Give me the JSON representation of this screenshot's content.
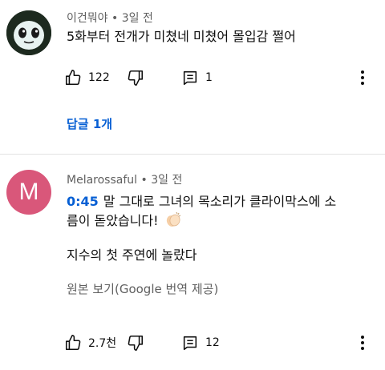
{
  "comments": [
    {
      "author": "이건뭐야",
      "time": "3일 전",
      "text": "5화부터 전개가 미쳤네 미쳤어 몰입감 쩔어",
      "likes": "122",
      "replies_count": "1",
      "view_replies_label": "답글 1개",
      "avatar_icon": "ghost-face-icon"
    },
    {
      "author": "Melarossaful",
      "time": "3일 전",
      "avatar_letter": "M",
      "avatar_color": "#d9577a",
      "timestamp": "0:45",
      "text_line1": "말 그대로 그녀의 목소리가 클라이막스에 소",
      "text_line2": "름이 돋았습니다!",
      "emoji_icon": "clapping-hands-icon",
      "text_line3": "지수의 첫 주연에 놀랐다",
      "translate_label": "원본 보기(Google 번역 제공)",
      "likes": "2.7천",
      "replies_count": "12"
    }
  ],
  "separator": "•",
  "colors": {
    "link": "#065fd4",
    "meta": "#606060",
    "text": "#0f0f0f"
  }
}
